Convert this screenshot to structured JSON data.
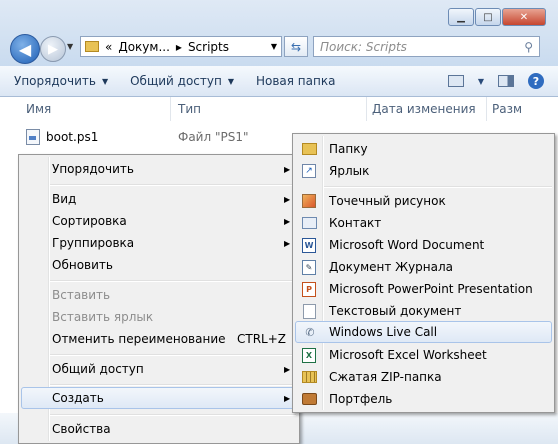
{
  "window": {
    "controls": {
      "minimize": "▁",
      "maximize": "□",
      "close": "✕"
    },
    "address": {
      "prefix": "«",
      "path_parent": "Докум...",
      "separator": "▸",
      "path_current": "Scripts"
    },
    "search": {
      "placeholder": "Поиск: Scripts"
    },
    "toolbar": {
      "organize": "Упорядочить",
      "share": "Общий доступ",
      "new_folder": "Новая папка"
    },
    "columns": {
      "name": "Имя",
      "type": "Тип",
      "date": "Дата изменения",
      "size": "Разм"
    },
    "file": {
      "name": "boot.ps1",
      "type": "Файл \"PS1\""
    }
  },
  "context_menu": {
    "organize": "Упорядочить",
    "view": "Вид",
    "sort": "Сортировка",
    "group": "Группировка",
    "refresh": "Обновить",
    "paste": "Вставить",
    "paste_shortcut": "Вставить ярлык",
    "undo_rename": "Отменить переименование",
    "undo_shortcut": "CTRL+Z",
    "share": "Общий доступ",
    "create": "Создать",
    "properties": "Свойства"
  },
  "submenu": {
    "folder": "Папку",
    "shortcut": "Ярлык",
    "bitmap": "Точечный рисунок",
    "contact": "Контакт",
    "word": "Microsoft Word Document",
    "journal": "Документ Журнала",
    "powerpoint": "Microsoft PowerPoint Presentation",
    "text": "Текстовый документ",
    "live_call": "Windows Live Call",
    "excel": "Microsoft Excel Worksheet",
    "zip": "Сжатая ZIP-папка",
    "briefcase": "Портфель"
  }
}
